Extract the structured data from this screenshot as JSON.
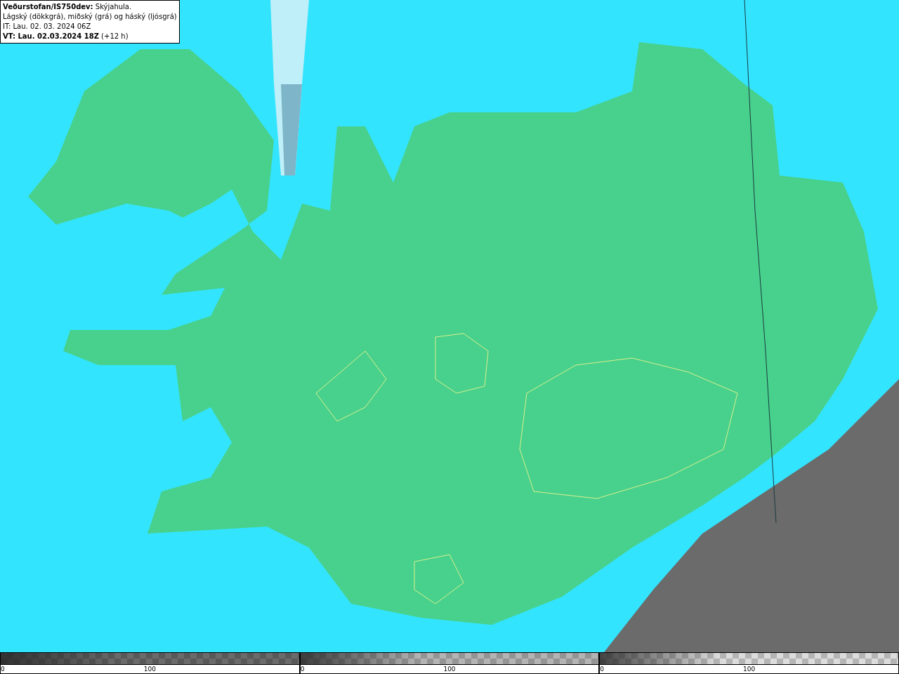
{
  "title_box": {
    "lines": [
      "**Veðurstofan/IS750dev:** Skýjahula.",
      "Lágský (dökkgrá), miðský (grá) og háský (ljósgrá)",
      "IT: Lau. 02. 03. 2024 06Z",
      "**VT: Lau. 02.03.2024 18Z** (+12 h)"
    ]
  },
  "legend": [
    {
      "color": "#6b6b6b",
      "min_label": "0",
      "max_label": "100"
    },
    {
      "color": "#b4b4b4",
      "min_label": "0",
      "max_label": "100"
    },
    {
      "color": "#dcdcdc",
      "min_label": "0",
      "max_label": "100"
    }
  ]
}
